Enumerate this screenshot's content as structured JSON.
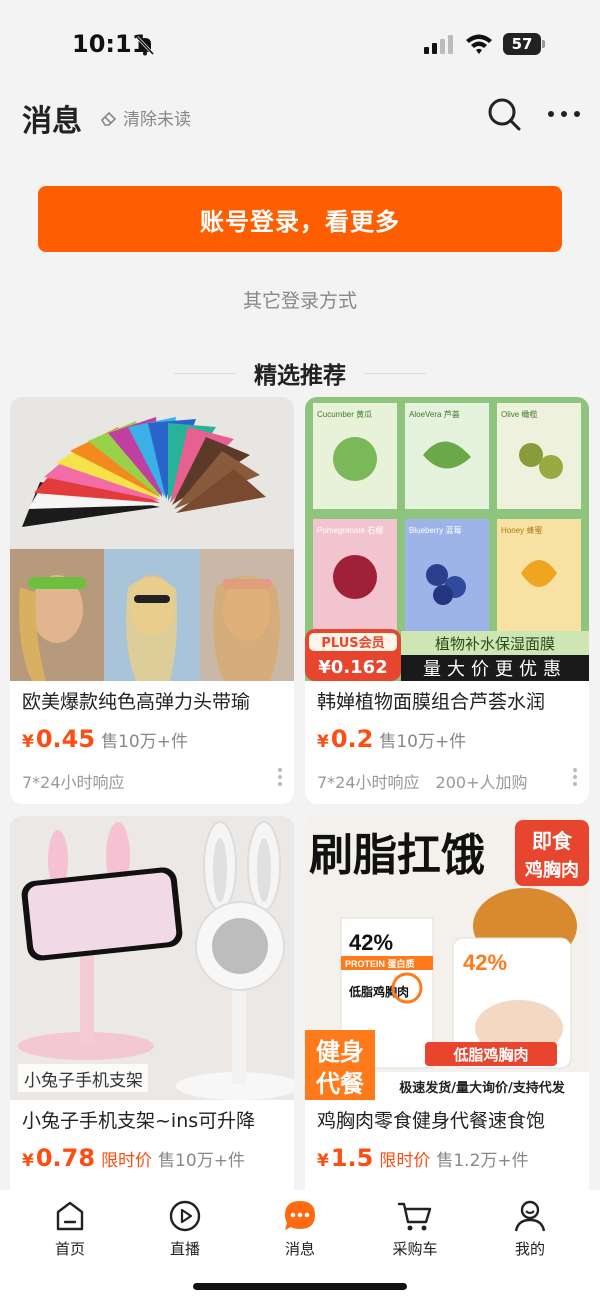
{
  "status_bar": {
    "time": "10:11",
    "battery": "57"
  },
  "header": {
    "title": "消息",
    "clear_unread": "清除未读"
  },
  "login": {
    "button_label": "账号登录，看更多",
    "other_methods": "其它登录方式"
  },
  "section": {
    "title": "精选推荐"
  },
  "products": [
    {
      "title": "欧美爆款纯色高弹力头带瑜",
      "price_symbol": "¥",
      "price": "0.45",
      "tag": "",
      "sold": "售10万+件",
      "service": "7*24小时响应",
      "extra": ""
    },
    {
      "title": "韩婵植物面膜组合芦荟水润",
      "price_symbol": "¥",
      "price": "0.2",
      "tag": "",
      "sold": "售10万+件",
      "service": "7*24小时响应",
      "extra": "200+人加购",
      "image_text": {
        "plus_label": "PLUS会员",
        "plus_price": "¥0.162",
        "banner_top": "植物补水保湿面膜",
        "banner_bottom": "量大价更优惠",
        "mask_labels": [
          "Cucumber 黄瓜",
          "AloeVera 芦荟",
          "Olive 橄榄",
          "Pomegranate 石榴",
          "Blueberry 蓝莓",
          "Honey 蜂蜜"
        ]
      }
    },
    {
      "title": "小兔子手机支架~ins可升降",
      "price_symbol": "¥",
      "price": "0.78",
      "tag": "限时价",
      "sold": "售10万+件",
      "service": "",
      "extra": "",
      "image_text": {
        "caption": "小兔子手机支架"
      }
    },
    {
      "title": "鸡胸肉零食健身代餐速食饱",
      "price_symbol": "¥",
      "price": "1.5",
      "tag": "限时价",
      "sold": "售1.2万+件",
      "service": "",
      "extra": "",
      "image_text": {
        "headline": "刷脂扛饿",
        "badge_line1": "即食",
        "badge_line2": "鸡胸肉",
        "pack_percent": "42%",
        "pack_protein": "PROTEIN 蛋白质",
        "pack_name": "低脂鸡胸肉",
        "side_line1": "健身",
        "side_line2": "代餐",
        "banner": "低脂鸡胸肉",
        "footer": "极速发货/量大询价/支持代发"
      }
    }
  ],
  "bottom_nav": [
    {
      "label": "首页",
      "icon": "home-icon"
    },
    {
      "label": "直播",
      "icon": "live-icon"
    },
    {
      "label": "消息",
      "icon": "message-icon"
    },
    {
      "label": "采购车",
      "icon": "cart-icon"
    },
    {
      "label": "我的",
      "icon": "profile-icon"
    }
  ],
  "colors": {
    "accent": "#ff5e00",
    "price": "#ff4d12",
    "background": "#f3f3f3"
  }
}
